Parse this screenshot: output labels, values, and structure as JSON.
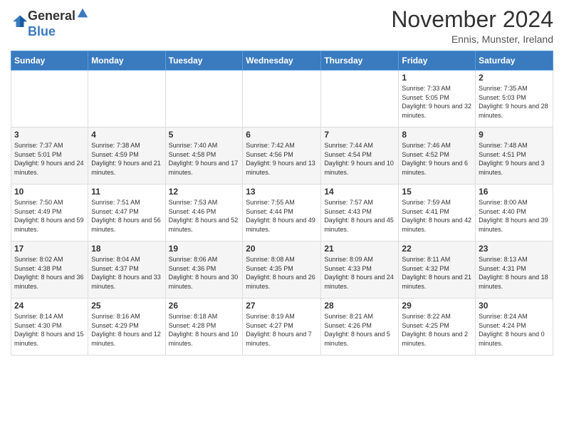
{
  "logo": {
    "general": "General",
    "blue": "Blue"
  },
  "header": {
    "month": "November 2024",
    "location": "Ennis, Munster, Ireland"
  },
  "weekdays": [
    "Sunday",
    "Monday",
    "Tuesday",
    "Wednesday",
    "Thursday",
    "Friday",
    "Saturday"
  ],
  "weeks": [
    [
      {
        "day": "",
        "info": ""
      },
      {
        "day": "",
        "info": ""
      },
      {
        "day": "",
        "info": ""
      },
      {
        "day": "",
        "info": ""
      },
      {
        "day": "",
        "info": ""
      },
      {
        "day": "1",
        "info": "Sunrise: 7:33 AM\nSunset: 5:05 PM\nDaylight: 9 hours and 32 minutes."
      },
      {
        "day": "2",
        "info": "Sunrise: 7:35 AM\nSunset: 5:03 PM\nDaylight: 9 hours and 28 minutes."
      }
    ],
    [
      {
        "day": "3",
        "info": "Sunrise: 7:37 AM\nSunset: 5:01 PM\nDaylight: 9 hours and 24 minutes."
      },
      {
        "day": "4",
        "info": "Sunrise: 7:38 AM\nSunset: 4:59 PM\nDaylight: 9 hours and 21 minutes."
      },
      {
        "day": "5",
        "info": "Sunrise: 7:40 AM\nSunset: 4:58 PM\nDaylight: 9 hours and 17 minutes."
      },
      {
        "day": "6",
        "info": "Sunrise: 7:42 AM\nSunset: 4:56 PM\nDaylight: 9 hours and 13 minutes."
      },
      {
        "day": "7",
        "info": "Sunrise: 7:44 AM\nSunset: 4:54 PM\nDaylight: 9 hours and 10 minutes."
      },
      {
        "day": "8",
        "info": "Sunrise: 7:46 AM\nSunset: 4:52 PM\nDaylight: 9 hours and 6 minutes."
      },
      {
        "day": "9",
        "info": "Sunrise: 7:48 AM\nSunset: 4:51 PM\nDaylight: 9 hours and 3 minutes."
      }
    ],
    [
      {
        "day": "10",
        "info": "Sunrise: 7:50 AM\nSunset: 4:49 PM\nDaylight: 8 hours and 59 minutes."
      },
      {
        "day": "11",
        "info": "Sunrise: 7:51 AM\nSunset: 4:47 PM\nDaylight: 8 hours and 56 minutes."
      },
      {
        "day": "12",
        "info": "Sunrise: 7:53 AM\nSunset: 4:46 PM\nDaylight: 8 hours and 52 minutes."
      },
      {
        "day": "13",
        "info": "Sunrise: 7:55 AM\nSunset: 4:44 PM\nDaylight: 8 hours and 49 minutes."
      },
      {
        "day": "14",
        "info": "Sunrise: 7:57 AM\nSunset: 4:43 PM\nDaylight: 8 hours and 45 minutes."
      },
      {
        "day": "15",
        "info": "Sunrise: 7:59 AM\nSunset: 4:41 PM\nDaylight: 8 hours and 42 minutes."
      },
      {
        "day": "16",
        "info": "Sunrise: 8:00 AM\nSunset: 4:40 PM\nDaylight: 8 hours and 39 minutes."
      }
    ],
    [
      {
        "day": "17",
        "info": "Sunrise: 8:02 AM\nSunset: 4:38 PM\nDaylight: 8 hours and 36 minutes."
      },
      {
        "day": "18",
        "info": "Sunrise: 8:04 AM\nSunset: 4:37 PM\nDaylight: 8 hours and 33 minutes."
      },
      {
        "day": "19",
        "info": "Sunrise: 8:06 AM\nSunset: 4:36 PM\nDaylight: 8 hours and 30 minutes."
      },
      {
        "day": "20",
        "info": "Sunrise: 8:08 AM\nSunset: 4:35 PM\nDaylight: 8 hours and 26 minutes."
      },
      {
        "day": "21",
        "info": "Sunrise: 8:09 AM\nSunset: 4:33 PM\nDaylight: 8 hours and 24 minutes."
      },
      {
        "day": "22",
        "info": "Sunrise: 8:11 AM\nSunset: 4:32 PM\nDaylight: 8 hours and 21 minutes."
      },
      {
        "day": "23",
        "info": "Sunrise: 8:13 AM\nSunset: 4:31 PM\nDaylight: 8 hours and 18 minutes."
      }
    ],
    [
      {
        "day": "24",
        "info": "Sunrise: 8:14 AM\nSunset: 4:30 PM\nDaylight: 8 hours and 15 minutes."
      },
      {
        "day": "25",
        "info": "Sunrise: 8:16 AM\nSunset: 4:29 PM\nDaylight: 8 hours and 12 minutes."
      },
      {
        "day": "26",
        "info": "Sunrise: 8:18 AM\nSunset: 4:28 PM\nDaylight: 8 hours and 10 minutes."
      },
      {
        "day": "27",
        "info": "Sunrise: 8:19 AM\nSunset: 4:27 PM\nDaylight: 8 hours and 7 minutes."
      },
      {
        "day": "28",
        "info": "Sunrise: 8:21 AM\nSunset: 4:26 PM\nDaylight: 8 hours and 5 minutes."
      },
      {
        "day": "29",
        "info": "Sunrise: 8:22 AM\nSunset: 4:25 PM\nDaylight: 8 hours and 2 minutes."
      },
      {
        "day": "30",
        "info": "Sunrise: 8:24 AM\nSunset: 4:24 PM\nDaylight: 8 hours and 0 minutes."
      }
    ]
  ]
}
